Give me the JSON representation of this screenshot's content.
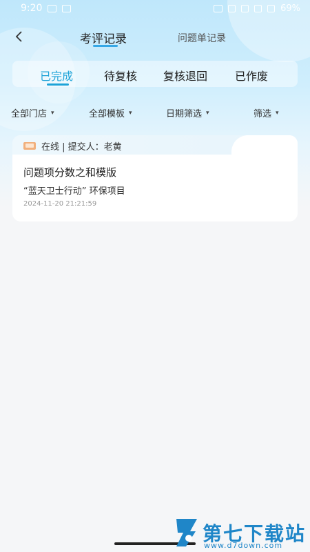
{
  "status_bar": {
    "time": "9:20",
    "battery": "69%"
  },
  "nav": {
    "tabs": [
      {
        "label": "考评记录",
        "active": true
      },
      {
        "label": "问题单记录",
        "active": false
      }
    ]
  },
  "segments": [
    {
      "label": "已完成",
      "active": true
    },
    {
      "label": "待复核",
      "active": false
    },
    {
      "label": "复核退回",
      "active": false
    },
    {
      "label": "已作废",
      "active": false
    }
  ],
  "filters": [
    {
      "label": "全部门店"
    },
    {
      "label": "全部模板"
    },
    {
      "label": "日期筛选"
    },
    {
      "label": "筛选"
    }
  ],
  "records": [
    {
      "header": "在线 | 提交人：老黄",
      "title": "问题项分数之和模版",
      "subtitle": "“蓝天卫士行动” 环保项目",
      "date": "2024-11-20 21:21:59"
    }
  ],
  "watermark": {
    "text": "第七下载站",
    "url": "www.d7down.com"
  },
  "colors": {
    "accent": "#1ea3d8",
    "header_gradient_top": "#bfe7fb",
    "background": "#f5f6f8"
  }
}
